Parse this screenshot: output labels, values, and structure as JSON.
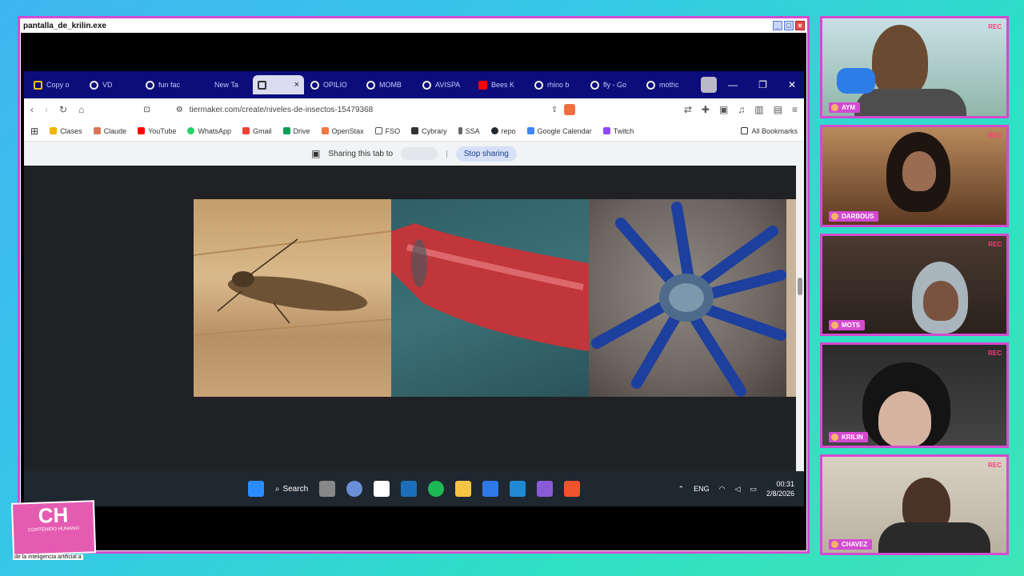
{
  "window": {
    "title": "pantalla_de_krilin.exe"
  },
  "browser": {
    "tabs": [
      {
        "label": "Copy o",
        "icon": "mail-icon"
      },
      {
        "label": "VD",
        "icon": "record-icon"
      },
      {
        "label": "fun fac",
        "icon": "google-icon"
      },
      {
        "label": "New Ta",
        "icon": "newtab-icon"
      },
      {
        "label": "",
        "icon": "tiermaker-icon",
        "active": true
      },
      {
        "label": "OPILIO",
        "icon": "google-icon"
      },
      {
        "label": "MOMB",
        "icon": "google-icon"
      },
      {
        "label": "AVISPA",
        "icon": "google-icon"
      },
      {
        "label": "Bees K",
        "icon": "youtube-icon"
      },
      {
        "label": "rhino b",
        "icon": "google-icon"
      },
      {
        "label": "fly - Go",
        "icon": "google-icon"
      },
      {
        "label": "mothc",
        "icon": "google-icon"
      }
    ],
    "url": "tiermaker.com/create/niveles-de-insectos-15479368",
    "bookmarks": [
      {
        "label": "Clases",
        "color": "#f4b400"
      },
      {
        "label": "Claude",
        "color": "#d97757"
      },
      {
        "label": "YouTube",
        "color": "#ff0000"
      },
      {
        "label": "WhatsApp",
        "color": "#25d366"
      },
      {
        "label": "Gmail",
        "color": "#ea4335"
      },
      {
        "label": "Drive",
        "color": "#0f9d58"
      },
      {
        "label": "OpenStax",
        "color": "#f47641"
      },
      {
        "label": "FSO",
        "color": "#555555"
      },
      {
        "label": "Cybrary",
        "color": "#333333"
      },
      {
        "label": "SSA",
        "color": "#666666"
      },
      {
        "label": "repo",
        "color": "#24292e"
      },
      {
        "label": "Google Calendar",
        "color": "#4285f4"
      },
      {
        "label": "Twitch",
        "color": "#9146ff"
      }
    ],
    "all_bookmarks": "All Bookmarks",
    "sharing_text": "Sharing this tab to",
    "stop_sharing": "Stop sharing"
  },
  "taskbar": {
    "search": "Search",
    "lang": "ENG",
    "time": "00:31",
    "date": "2/8/2026"
  },
  "cams": [
    {
      "name": "AYM",
      "rec": "REC"
    },
    {
      "name": "DARBOUS",
      "rec": "REC"
    },
    {
      "name": "MOTS",
      "rec": "REC"
    },
    {
      "name": "KRILIN",
      "rec": "REC"
    },
    {
      "name": "CHAVEZ",
      "rec": "REC"
    }
  ],
  "logo": {
    "main": "CH",
    "sub": "CONTENIDO HUMANO",
    "caption": "de la inteligencia artificial a"
  }
}
